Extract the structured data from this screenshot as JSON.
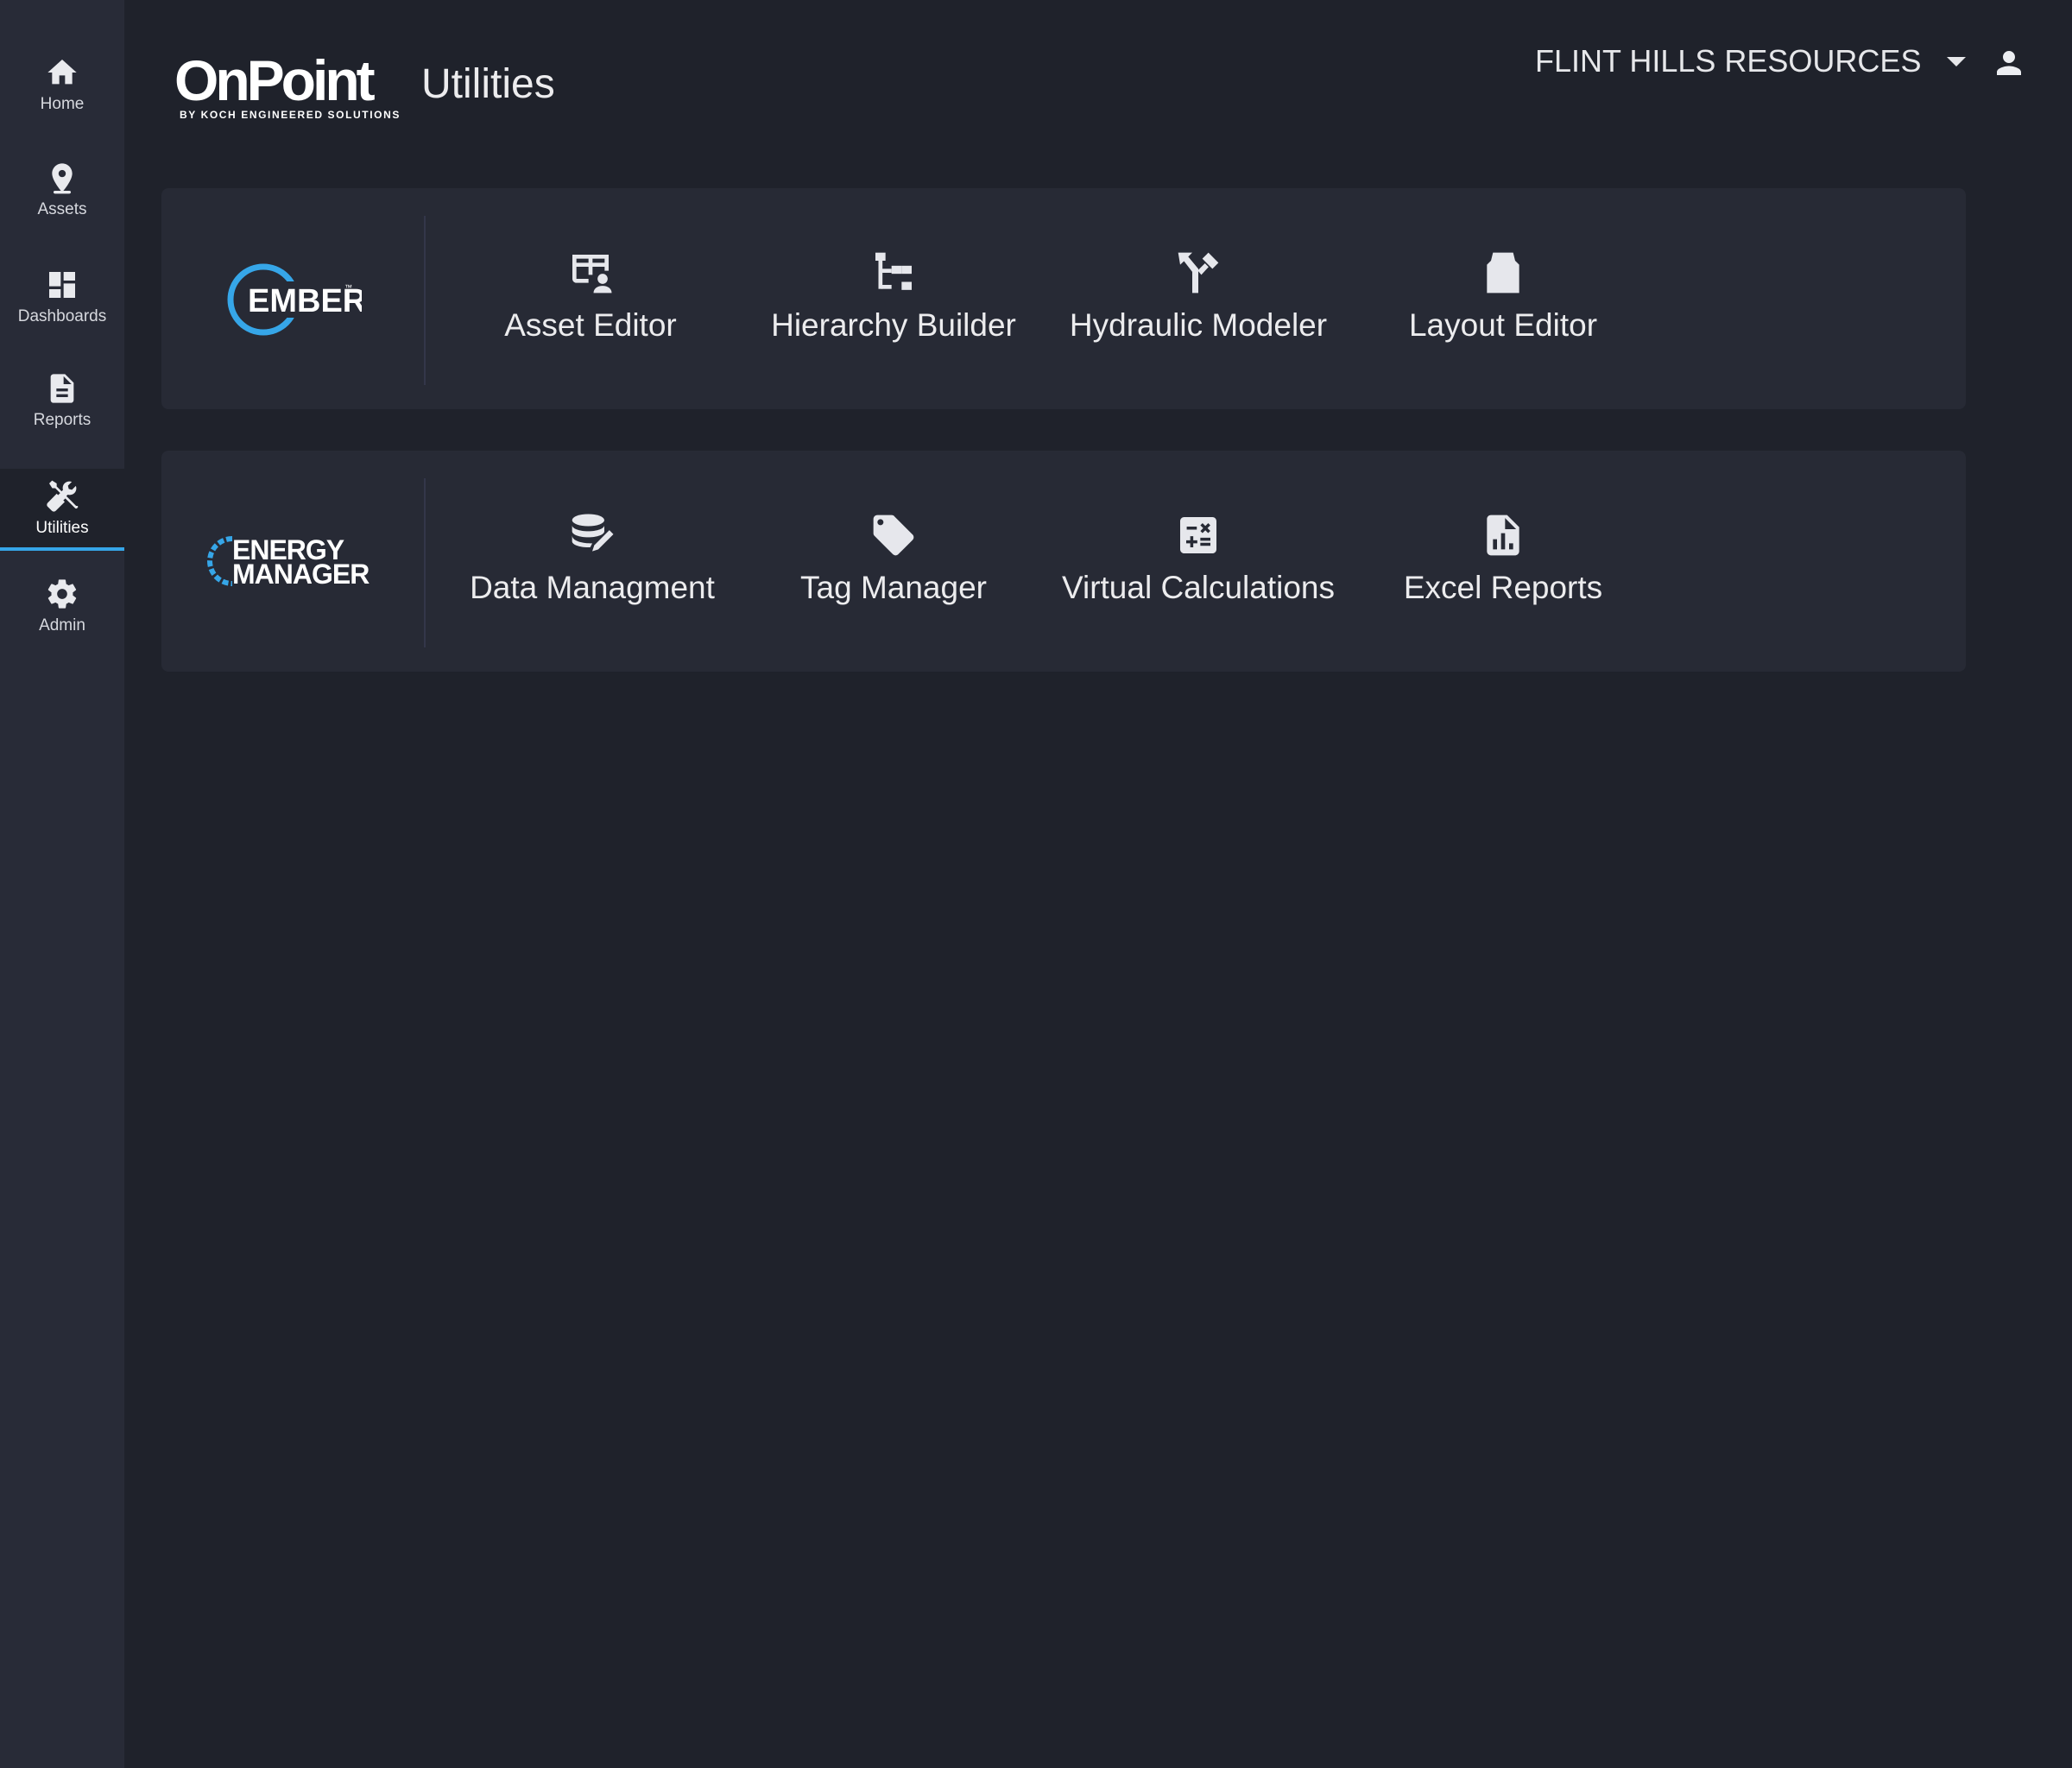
{
  "header": {
    "logo_text": "OnPoint",
    "logo_subtext": "BY KOCH ENGINEERED SOLUTIONS",
    "page_title": "Utilities",
    "org_selected": "FLINT HILLS RESOURCES"
  },
  "sidebar": {
    "items": [
      {
        "label": "Home",
        "icon": "home-icon"
      },
      {
        "label": "Assets",
        "icon": "map-pin-icon"
      },
      {
        "label": "Dashboards",
        "icon": "dashboard-icon"
      },
      {
        "label": "Reports",
        "icon": "document-icon"
      },
      {
        "label": "Utilities",
        "icon": "tools-icon",
        "active": true
      },
      {
        "label": "Admin",
        "icon": "gear-icon"
      }
    ]
  },
  "sections": [
    {
      "logo": "EMBER",
      "logo_trademark": "™",
      "tiles": [
        {
          "label": "Asset Editor",
          "icon": "asset-table-icon"
        },
        {
          "label": "Hierarchy Builder",
          "icon": "hierarchy-icon"
        },
        {
          "label": "Hydraulic Modeler",
          "icon": "merge-arrows-icon"
        },
        {
          "label": "Layout Editor",
          "icon": "layout-icon"
        }
      ]
    },
    {
      "logo_line1": "ENERGY",
      "logo_line2": "MANAGER",
      "tiles": [
        {
          "label": "Data Managment",
          "icon": "database-edit-icon"
        },
        {
          "label": "Tag Manager",
          "icon": "tag-icon"
        },
        {
          "label": "Virtual Calculations",
          "icon": "calculator-icon"
        },
        {
          "label": "Excel Reports",
          "icon": "file-chart-icon"
        }
      ]
    }
  ],
  "colors": {
    "background": "#1f222b",
    "sidebar": "#282b37",
    "card": "#272a35",
    "active_indicator": "#36a6e8",
    "logo_accent": "#7dc243",
    "ember_ring": "#36a6e8"
  }
}
